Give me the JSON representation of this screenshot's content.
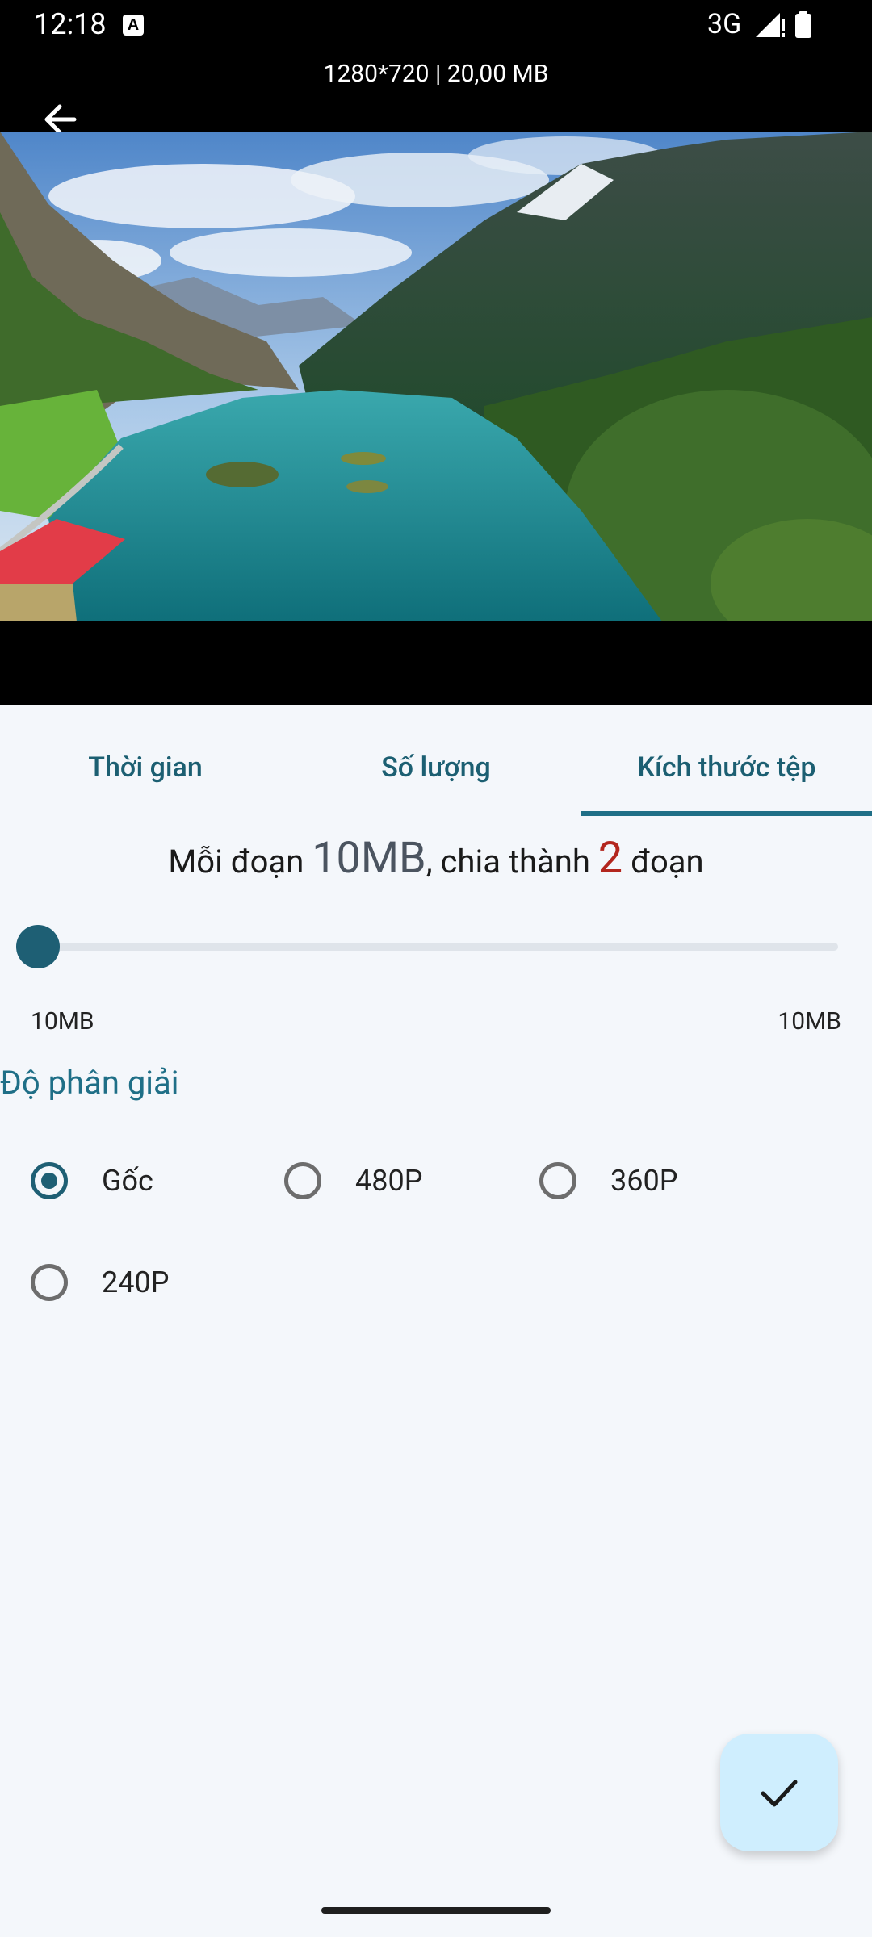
{
  "status_bar": {
    "time": "12:18",
    "network": "3G",
    "notification_icon": "a-letter-icon",
    "signal_icon": "signal-icon",
    "battery_icon": "battery-icon"
  },
  "video": {
    "info": "1280*720 | 20,00 MB",
    "back_icon": "arrow-back-icon"
  },
  "tabs": [
    {
      "label": "Thời gian",
      "selected": false
    },
    {
      "label": "Số lượng",
      "selected": false
    },
    {
      "label": "Kích thước tệp",
      "selected": true
    }
  ],
  "summary": {
    "prefix": "Mỗi đoạn ",
    "size": "10MB",
    "middle": ", chia thành ",
    "count": "2",
    "suffix": " đoạn"
  },
  "slider": {
    "min_label": "10MB",
    "max_label": "10MB",
    "value_fraction": 0
  },
  "resolution": {
    "title": "Độ phân giải",
    "options": [
      {
        "label": "Gốc",
        "checked": true
      },
      {
        "label": "480P",
        "checked": false
      },
      {
        "label": "360P",
        "checked": false
      },
      {
        "label": "240P",
        "checked": false
      }
    ]
  },
  "fab": {
    "icon": "check-icon"
  },
  "colors": {
    "accent": "#1f6f87",
    "highlight_red": "#b3261e",
    "fab_bg": "#cfeefe",
    "page_bg": "#f4f7fb"
  }
}
